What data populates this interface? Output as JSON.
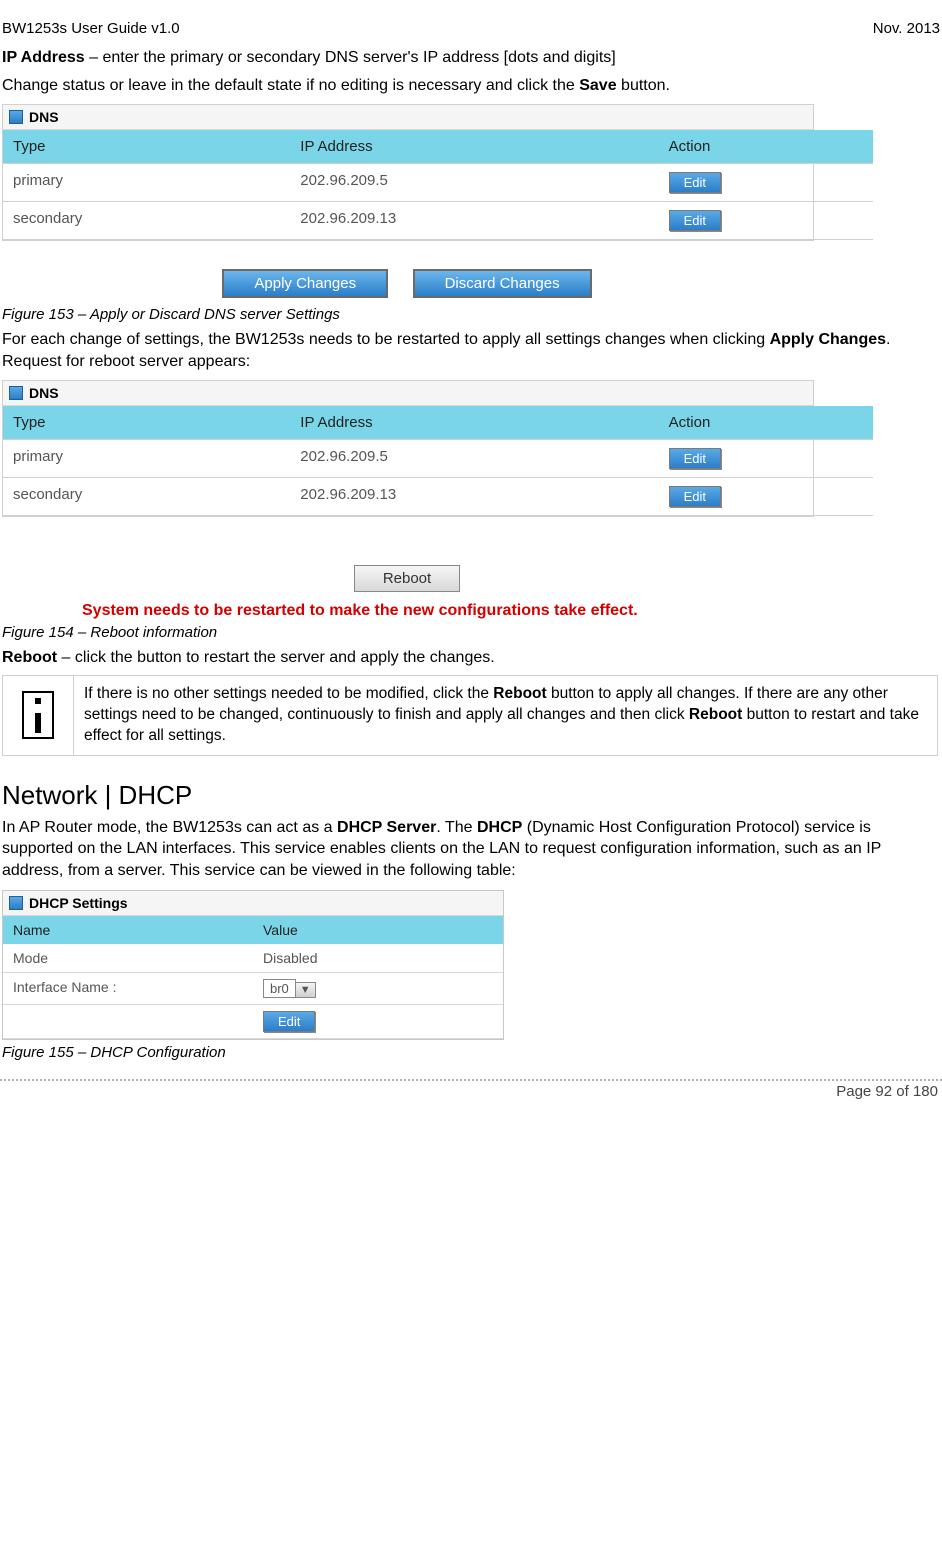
{
  "header": {
    "left": "BW1253s User Guide v1.0",
    "right": "Nov.  2013"
  },
  "intro": {
    "ip_line_strong": "IP Address",
    "ip_line_rest": " – enter the primary or secondary DNS server's IP address [dots and digits]",
    "change_pre": "Change status or leave in the default state if no editing is necessary and click the ",
    "save_word": "Save",
    "change_post": " button."
  },
  "dns_panel": {
    "title": "DNS",
    "headers": {
      "type": "Type",
      "ip": "IP Address",
      "action": "Action"
    },
    "rows": [
      {
        "type": "primary",
        "ip": "202.96.209.5",
        "btn": "Edit"
      },
      {
        "type": "secondary",
        "ip": "202.96.209.13",
        "btn": "Edit"
      }
    ],
    "apply_btn": "Apply Changes",
    "discard_btn": "Discard Changes"
  },
  "fig153": "Figure 153 – Apply or Discard DNS server Settings",
  "para_after_153_pre": "For each change of settings, the BW1253s needs to be restarted to apply all settings changes when clicking ",
  "apply_bold": "Apply Changes",
  "para_after_153_post": ". Request for reboot server appears:",
  "reboot_btn": "Reboot",
  "reboot_msg": "System needs to be restarted to make the new configurations take effect.",
  "fig154": "Figure 154 – Reboot information",
  "reboot_line_strong": "Reboot",
  "reboot_line_rest": " – click the button to restart the server and apply the changes.",
  "info_box": {
    "t1": "If there is no other settings needed to be modified, click the ",
    "b1": "Reboot",
    "t2": " button to apply all changes. If there are any other settings need to be changed, continuously to finish and apply all changes and then click ",
    "b2": "Reboot",
    "t3": " button to restart and take effect  for all settings."
  },
  "section_title": "Network | DHCP",
  "dhcp_para": {
    "t1": "In AP Router mode, the BW1253s can act as a ",
    "b1": "DHCP Server",
    "t2": ". The ",
    "b2": "DHCP",
    "t3": " (Dynamic Host Configuration Protocol) service is supported on the LAN interfaces. This service enables clients on the LAN to request configuration information, such as an IP address, from a server. This service can be viewed in the following table:"
  },
  "dhcp_panel": {
    "title": "DHCP Settings",
    "name_h": "Name",
    "value_h": "Value",
    "rows": [
      {
        "name": "Mode",
        "value": "Disabled"
      },
      {
        "name": "Interface Name :",
        "value_combo": "br0"
      }
    ],
    "edit_btn": "Edit"
  },
  "fig155": "Figure 155 – DHCP Configuration",
  "footer": "Page 92 of 180"
}
